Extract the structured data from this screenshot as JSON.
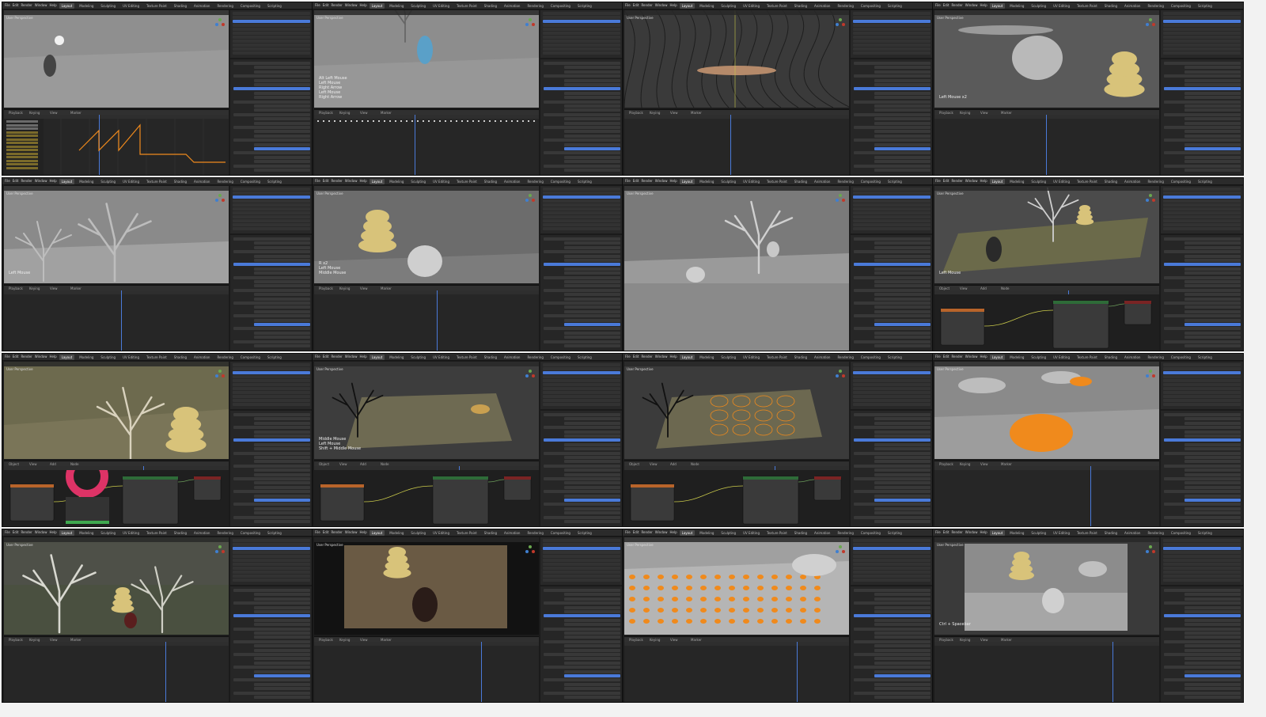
{
  "app": {
    "menus": [
      "File",
      "Edit",
      "Render",
      "Window",
      "Help"
    ],
    "workspaces": [
      "Layout",
      "Modeling",
      "Sculpting",
      "UV Editing",
      "Texture Paint",
      "Shading",
      "Animation",
      "Rendering",
      "Compositing",
      "Scripting"
    ],
    "active_workspace": "Layout",
    "editor_labels": {
      "playback": "Playback",
      "keying": "Keying",
      "view": "View",
      "marker": "Marker",
      "object": "Object",
      "add": "Add",
      "node": "Node"
    },
    "viewport_title": "User Perspective"
  },
  "colors": {
    "selection_orange": "#f08a1c",
    "highlight_blue": "#4a7ad9",
    "panel_bg": "#262626",
    "header_bg": "#303030",
    "viewport_grey": "#8c8c8c",
    "node_green": "#2e6b38",
    "node_orange": "#b8642a",
    "node_red": "#7a2424"
  },
  "tiles": [
    {
      "id": 1,
      "overlay": "",
      "scene": "walker",
      "timeline": "graph"
    },
    {
      "id": 2,
      "overlay": "Alt Left Mouse\nLeft Mouse\nRight Arrow\nLeft Mouse\nRight Arrow",
      "scene": "tree-creature",
      "timeline": "dopesheet"
    },
    {
      "id": 3,
      "overlay": "",
      "scene": "wire-bee",
      "timeline": "empty"
    },
    {
      "id": 4,
      "overlay": "Left Mouse x2",
      "scene": "bee-hive",
      "timeline": "empty"
    },
    {
      "id": 5,
      "overlay": "Left Mouse",
      "scene": "tree-menu",
      "timeline": "empty"
    },
    {
      "id": 6,
      "overlay": "R x2\nLeft Mouse\nMiddle Mouse",
      "scene": "hive-creature",
      "timeline": "empty"
    },
    {
      "id": 7,
      "overlay": "",
      "scene": "tree-ground",
      "timeline": "none"
    },
    {
      "id": 8,
      "overlay": "Left Mouse",
      "scene": "grass-scene",
      "timeline": "nodes"
    },
    {
      "id": 9,
      "overlay": "",
      "scene": "leaf-hive",
      "timeline": "colorpicker"
    },
    {
      "id": 10,
      "overlay": "Middle Mouse\nLeft Mouse\nShift + Middle Mouse",
      "scene": "dark-tree-plane",
      "timeline": "nodes"
    },
    {
      "id": 11,
      "overlay": "",
      "scene": "tree-rocks",
      "timeline": "nodes"
    },
    {
      "id": 12,
      "overlay": "",
      "scene": "orange-scatter",
      "timeline": "empty"
    },
    {
      "id": 13,
      "overlay": "",
      "scene": "forest",
      "timeline": "empty"
    },
    {
      "id": 14,
      "overlay": "",
      "scene": "render-creature",
      "timeline": "empty"
    },
    {
      "id": 15,
      "overlay": "",
      "scene": "mushrooms",
      "timeline": "empty"
    },
    {
      "id": 16,
      "overlay": "Ctrl + Spacebar",
      "scene": "camera-view",
      "timeline": "empty"
    }
  ]
}
